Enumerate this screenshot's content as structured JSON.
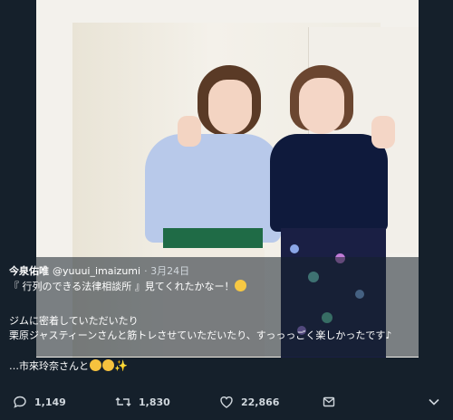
{
  "tweet": {
    "author_name": "今泉佑唯",
    "author_handle": "@yuuui_imaizumi",
    "date": "· 3月24日",
    "line1": "『 行列のできる法律相談所 』見てくれたかなー！",
    "line2": "ジムに密着していただいたり",
    "line3": "栗原ジャスティーンさんと筋トレさせていただいたり、すっっっごく楽しかったです♪",
    "line4": "…市來玲奈さんと"
  },
  "actions": {
    "reply_count": "1,149",
    "retweet_count": "1,830",
    "like_count": "22,866"
  },
  "icons": {
    "reply": "reply-icon",
    "retweet": "retweet-icon",
    "like": "heart-icon",
    "share": "share-icon",
    "more": "chevron-down-icon"
  }
}
